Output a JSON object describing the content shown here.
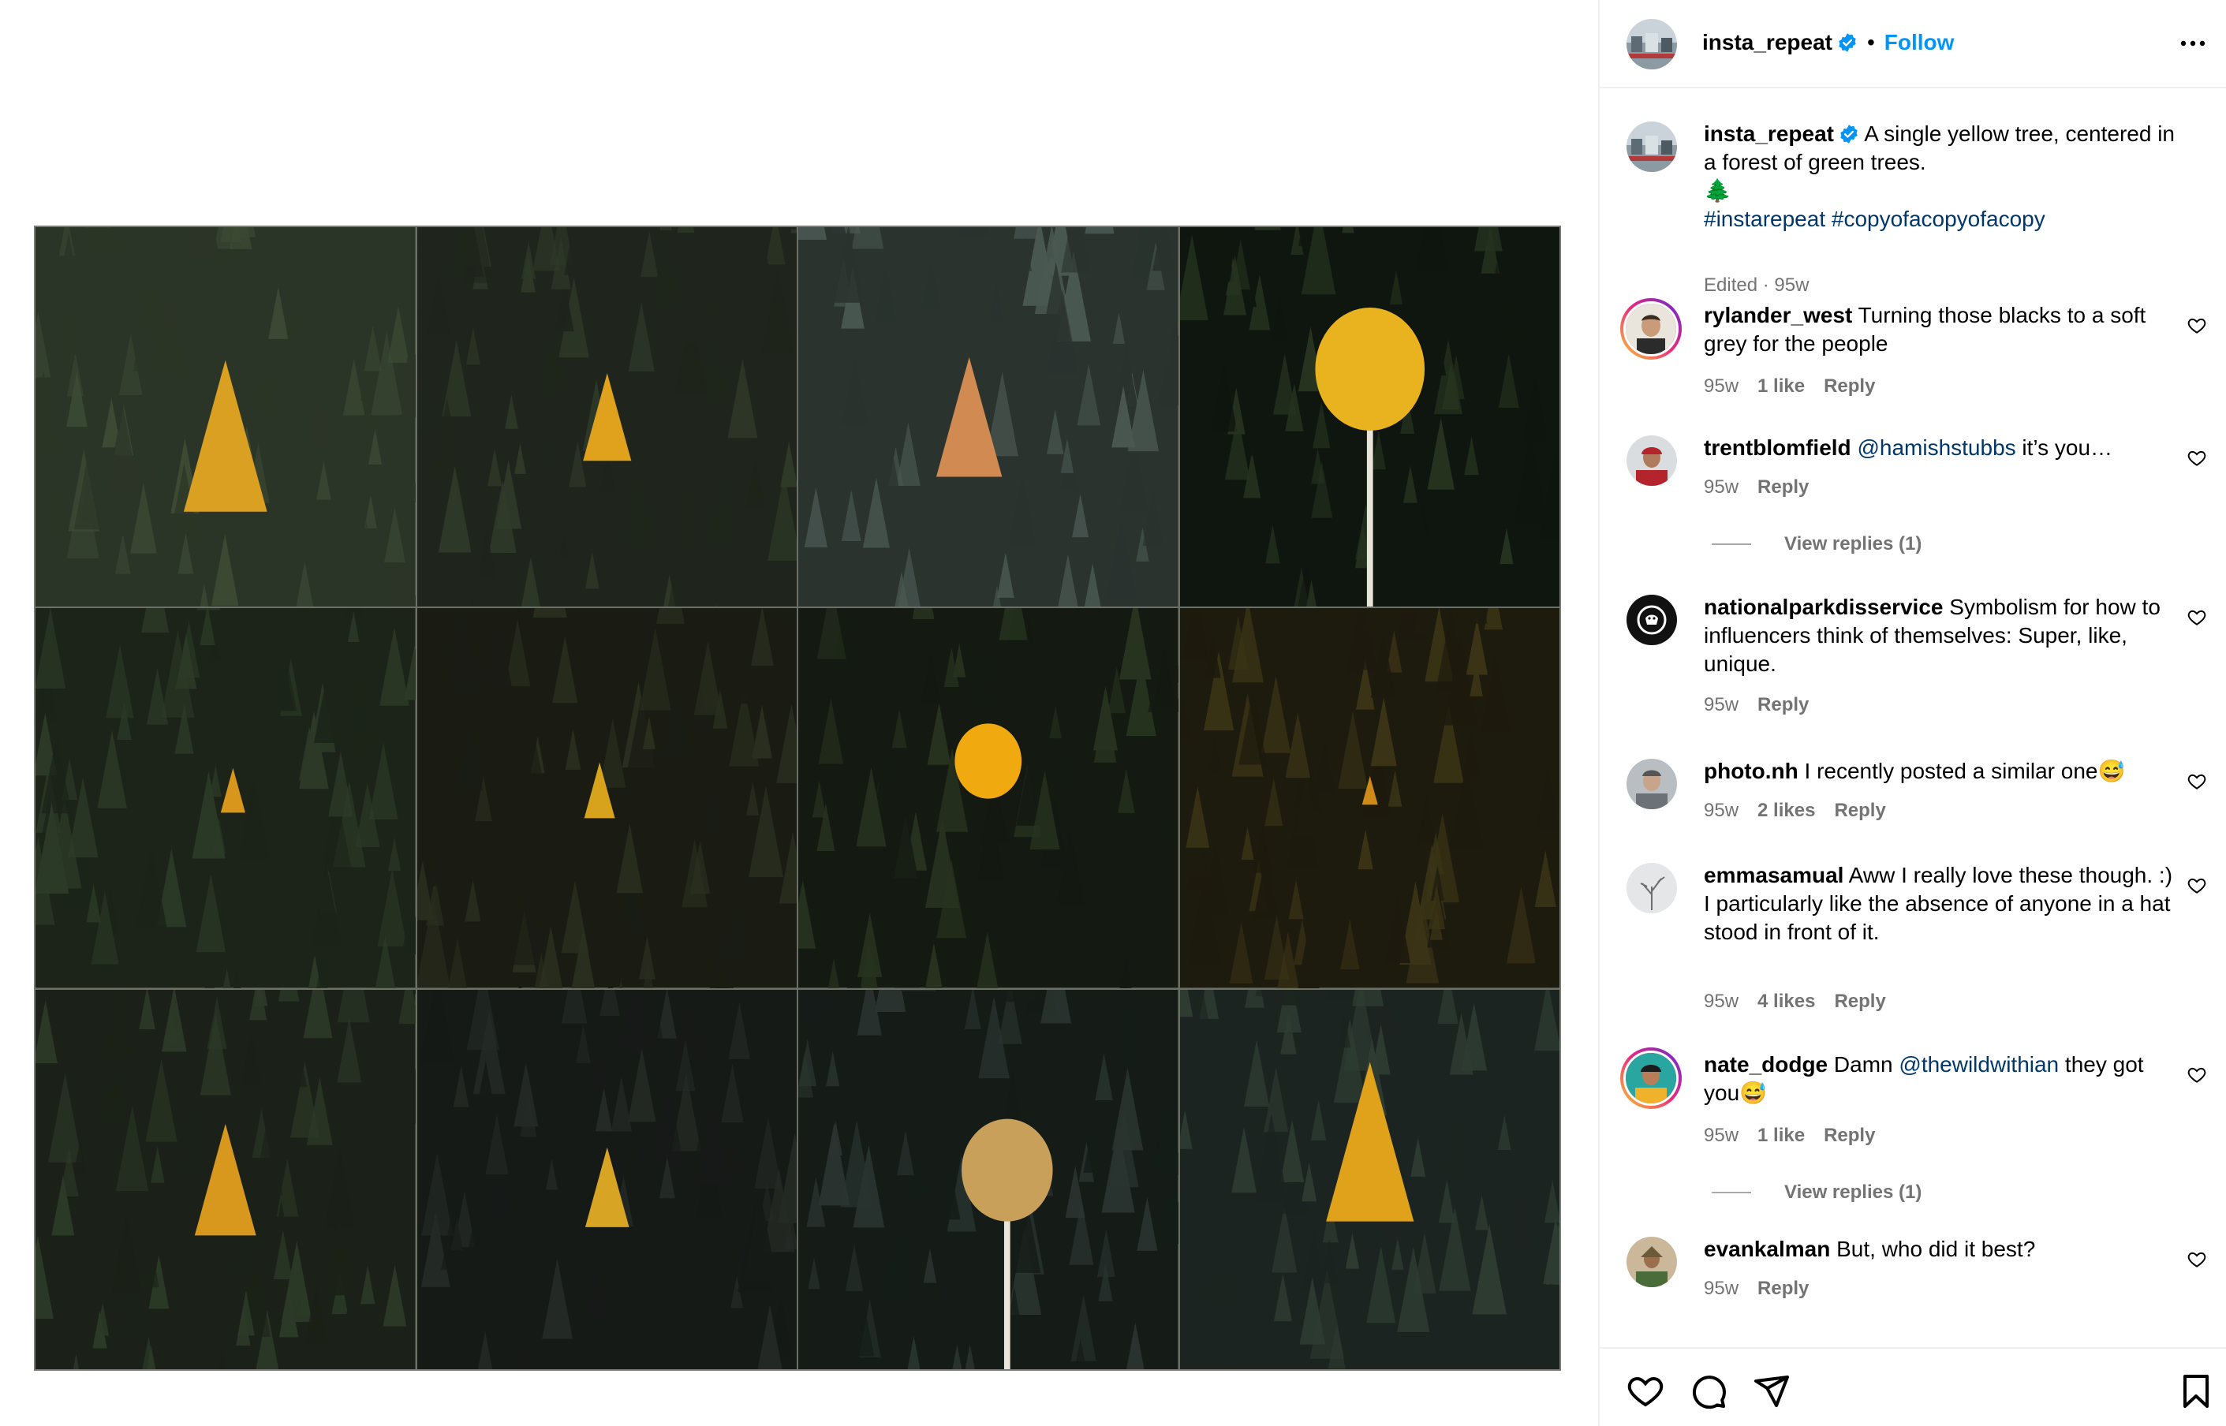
{
  "post": {
    "username": "insta_repeat",
    "follow_label": "Follow",
    "separator": "•",
    "caption": "A single yellow tree, centered in a forest of green trees.",
    "emoji": "🌲",
    "hashtags": "#instarepeat #copyofacopyofacopy",
    "edited": "Edited · 95w"
  },
  "comments": [
    {
      "user": "rylander_west",
      "text": "Turning those blacks to a soft grey for the people",
      "time": "95w",
      "likes": "1 like",
      "reply": "Reply"
    },
    {
      "user": "trentblomfield",
      "mention": "@hamishstubbs",
      "text": " it’s you…",
      "time": "95w",
      "reply": "Reply",
      "view_replies": "View replies (1)"
    },
    {
      "user": "nationalparkdisservice",
      "text": "Symbolism for how to influencers think of themselves: Super, like, unique.",
      "time": "95w",
      "reply": "Reply"
    },
    {
      "user": "photo.nh",
      "text": "I recently posted a similar one😅",
      "time": "95w",
      "likes": "2 likes",
      "reply": "Reply"
    },
    {
      "user": "emmasamual",
      "text": "Aww I really love these though. :)",
      "text2": "I particularly like the absence of anyone in a hat stood in front of it.",
      "time": "95w",
      "likes": "4 likes",
      "reply": "Reply"
    },
    {
      "user": "nate_dodge",
      "pre": "Damn ",
      "mention": "@thewildwithian",
      "text": " they got you😅",
      "time": "95w",
      "likes": "1 like",
      "reply": "Reply",
      "view_replies": "View replies (1)"
    },
    {
      "user": "evankalman",
      "text": "But, who did it best?",
      "time": "95w",
      "reply": "Reply"
    }
  ],
  "icons": [
    "more-icon",
    "heart-icon",
    "comment-icon",
    "share-icon",
    "save-icon",
    "verified-badge-icon"
  ],
  "colors": {
    "accent": "#0095f6",
    "link": "#00376b",
    "muted": "#737373",
    "yellow_tree": "#e8a21a"
  }
}
